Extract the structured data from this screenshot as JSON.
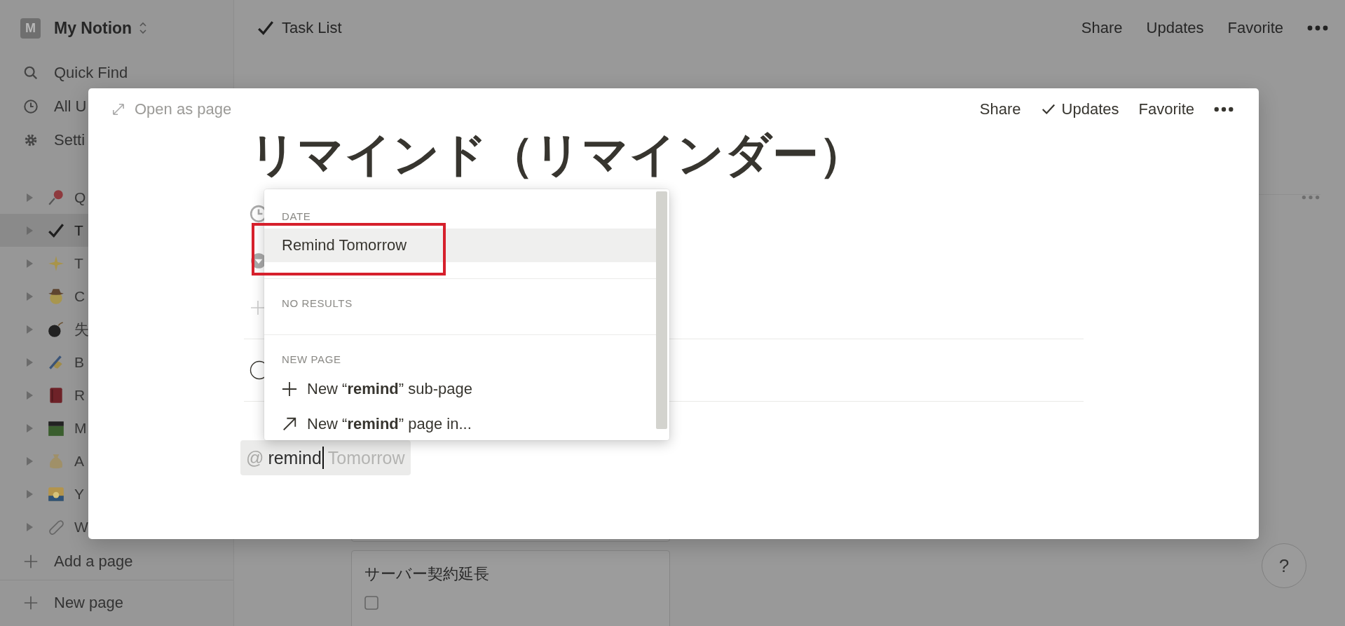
{
  "sidebar": {
    "workspace": {
      "initial": "M",
      "name": "My Notion"
    },
    "nav": [
      {
        "label": "Quick Find"
      },
      {
        "label": "All U"
      },
      {
        "label": "Setti"
      }
    ],
    "pages": [
      {
        "label": "Q",
        "selected": false
      },
      {
        "label": "T",
        "selected": true
      },
      {
        "label": "T",
        "selected": false
      },
      {
        "label": "C",
        "selected": false
      },
      {
        "label": "失",
        "selected": false
      },
      {
        "label": "B",
        "selected": false
      },
      {
        "label": "R",
        "selected": false
      },
      {
        "label": "M",
        "selected": false
      },
      {
        "label": "A",
        "selected": false
      },
      {
        "label": "Y",
        "selected": false
      },
      {
        "label": "W",
        "selected": false
      }
    ],
    "add_page": "Add a page",
    "new_page": "New page"
  },
  "topbar": {
    "title": "Task List",
    "actions": [
      "Share",
      "Updates",
      "Favorite"
    ]
  },
  "board": {
    "cards": [
      {
        "title": "サーバー契約延長"
      }
    ]
  },
  "help": "?",
  "modal": {
    "open_as_page": "Open as page",
    "actions": [
      "Share",
      "Updates",
      "Favorite"
    ],
    "title": "リマインド（リマインダー）",
    "mention": {
      "prefix": "@",
      "value": "remind",
      "suggestion": "Tomorrow"
    }
  },
  "menu": {
    "sections": [
      {
        "heading": "DATE",
        "items": [
          {
            "kind": "date",
            "label": "Remind Tomorrow",
            "selected": true,
            "highlighted": true
          }
        ]
      },
      {
        "heading": "NO RESULTS"
      },
      {
        "heading": "NEW PAGE",
        "items": [
          {
            "kind": "subpage",
            "label": "New “**remind**” sub-page",
            "selected": false,
            "highlighted": false
          },
          {
            "kind": "page_in",
            "label": "New “**remind**” page in...",
            "selected": false,
            "highlighted": false
          }
        ]
      }
    ]
  }
}
